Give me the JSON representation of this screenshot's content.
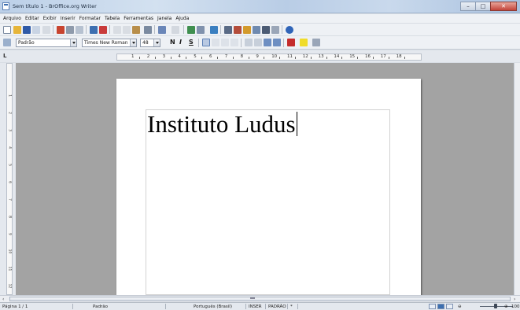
{
  "window": {
    "title": "Sem título 1 - BrOffice.org Writer"
  },
  "menu": [
    "Arquivo",
    "Editar",
    "Exibir",
    "Inserir",
    "Formatar",
    "Tabela",
    "Ferramentas",
    "Janela",
    "Ajuda"
  ],
  "formatting": {
    "style": "Padrão",
    "font": "Times New Roman",
    "size": "48",
    "bold_label": "N",
    "italic_label": "I",
    "underline_label": "S"
  },
  "ruler": {
    "numbers": [
      "1",
      "2",
      "3",
      "4",
      "5",
      "6",
      "7",
      "8",
      "9",
      "10",
      "11",
      "12",
      "13",
      "14",
      "15",
      "16",
      "17",
      "18"
    ]
  },
  "vruler": {
    "numbers": [
      "1",
      "2",
      "3",
      "4",
      "5",
      "6",
      "7",
      "8",
      "9",
      "10",
      "11",
      "12"
    ]
  },
  "document": {
    "text": "Instituto Ludus"
  },
  "status": {
    "page": "Página 1 / 1",
    "style": "Padrão",
    "language": "Português (Brasil)",
    "insert_mode": "INSER",
    "selection_mode": "PADRÃO",
    "modified": "*",
    "zoom": "100"
  },
  "colors": {
    "workspace": "#a3a3a3",
    "page": "#ffffff",
    "titlebar": "#c9d9ec"
  }
}
